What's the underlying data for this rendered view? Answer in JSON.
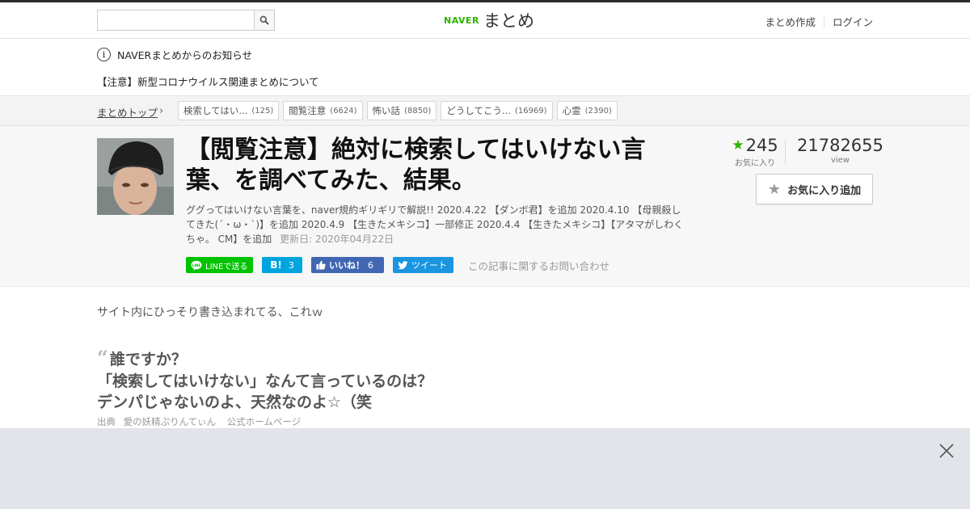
{
  "header": {
    "search": {
      "placeholder": "",
      "value": ""
    },
    "logo": {
      "naver": "NAVER",
      "matome": "まとめ"
    },
    "links": {
      "create": "まとめ作成",
      "login": "ログイン"
    }
  },
  "notice": {
    "title": "NAVERまとめからのお知らせ",
    "item": "【注意】新型コロナウイルス関連まとめについて"
  },
  "breadcrumb": {
    "top": "まとめトップ",
    "tags": [
      {
        "label": "検索してはい...",
        "count": "(125)"
      },
      {
        "label": "閲覧注意",
        "count": "(6624)"
      },
      {
        "label": "怖い話",
        "count": "(8850)"
      },
      {
        "label": "どうしてこう...",
        "count": "(16969)"
      },
      {
        "label": "心霊",
        "count": "(2390)"
      }
    ]
  },
  "article": {
    "title": "【閲覧注意】絶対に検索してはいけない言葉、を調べてみた、結果。",
    "description": "ググってはいけない言葉を、naver規約ギリギリで解説!! 2020.4.22 【ダンボ君】を追加 2020.4.10 【母親殺してきた(´・ω・`)】を追加 2020.4.9 【生きたメキシコ】一部修正 2020.4.4 【生きたメキシコ】【アタマがしわくちゃ。 CM】を追加",
    "updated": "更新日: 2020年04月22日",
    "social": {
      "line": "LINEで送る",
      "hatena": "B!",
      "hatena_count": "3",
      "fb": "いいね！",
      "fb_count": "6",
      "tweet": "ツイート"
    },
    "inquiry": "この記事に関するお問い合わせ",
    "stats": {
      "favorites": "245",
      "favorites_label": "お気に入り",
      "views": "21782655",
      "views_label": "view"
    },
    "fav_button": "お気に入り追加",
    "accent_color": "#2db400"
  },
  "body": {
    "lead": "サイト内にひっそり書き込まれてる、これｗ",
    "quote": [
      "誰ですか？",
      "「検索してはいけない」なんて言っているのは？",
      "デンパじゃないのよ、天然なのよ☆（笑"
    ],
    "source_label": "出典",
    "source_name": "愛の妖精ぷりんてぃん",
    "source_ref": "公式ホームページ"
  }
}
